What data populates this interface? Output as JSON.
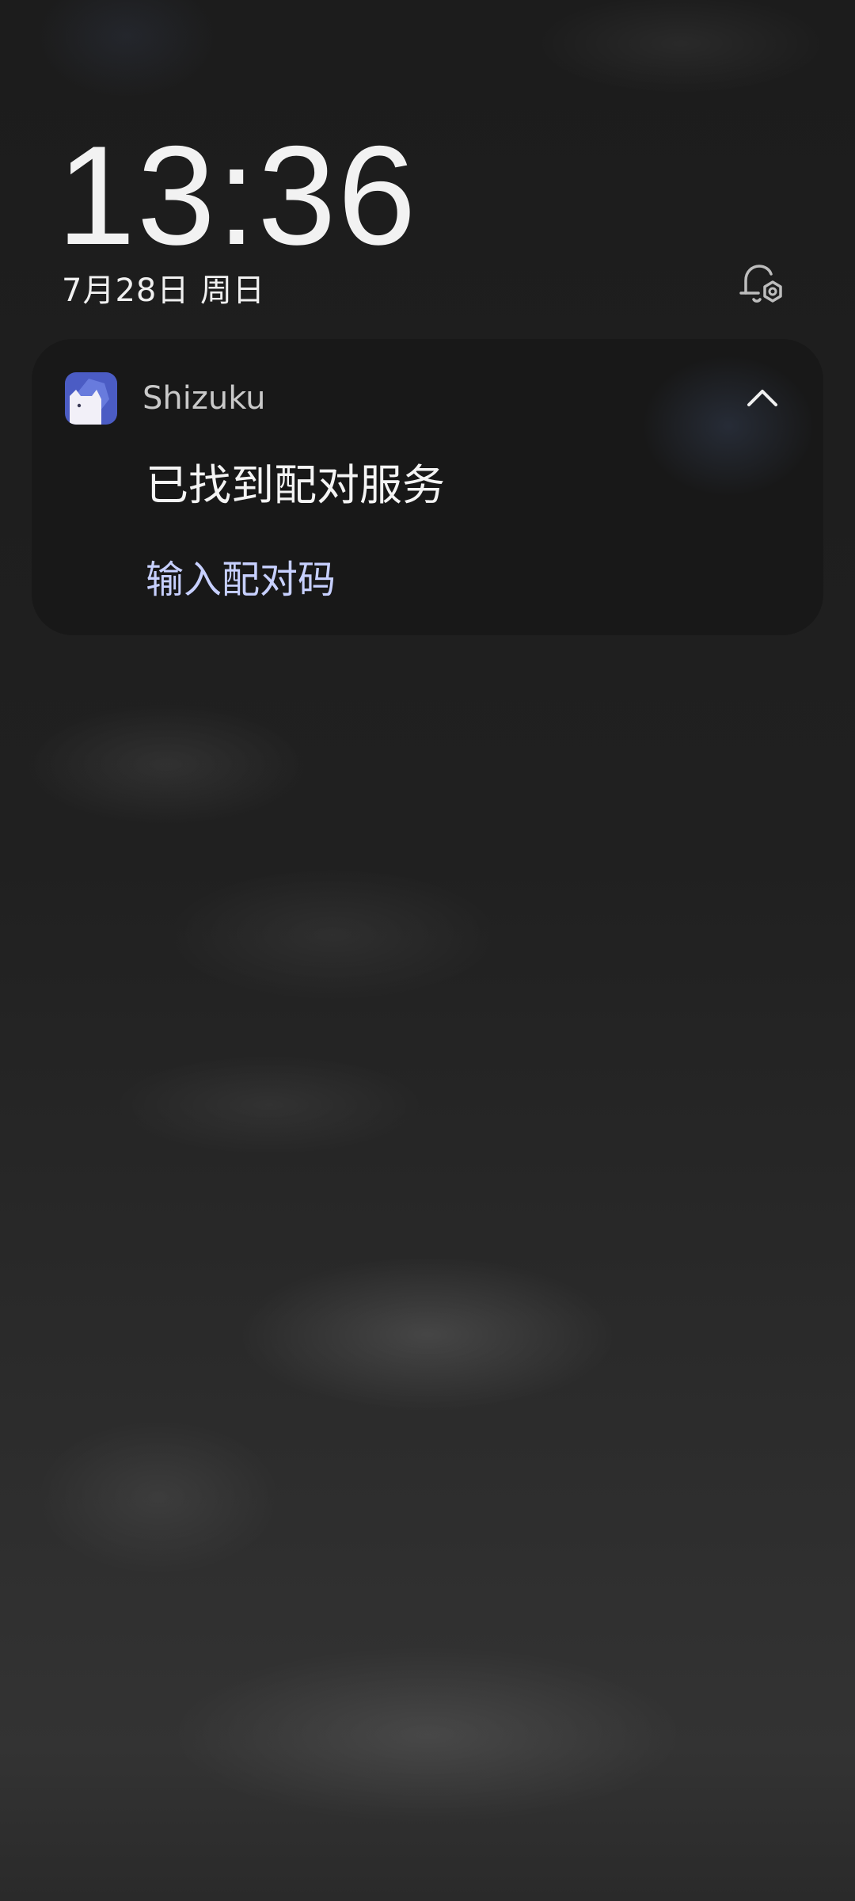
{
  "lockscreen": {
    "time": "13:36",
    "date": "7月28日 周日",
    "notification_settings_icon": "bell-gear-icon"
  },
  "notification": {
    "app_name": "Shizuku",
    "app_icon": "shizuku-app-icon",
    "title": "已找到配对服务",
    "action_label": "输入配对码",
    "collapse_icon": "chevron-up-icon"
  },
  "colors": {
    "app_icon_bg": "#4b5cc4",
    "action_text": "#c7d0ff",
    "card_bg": "#181818"
  }
}
